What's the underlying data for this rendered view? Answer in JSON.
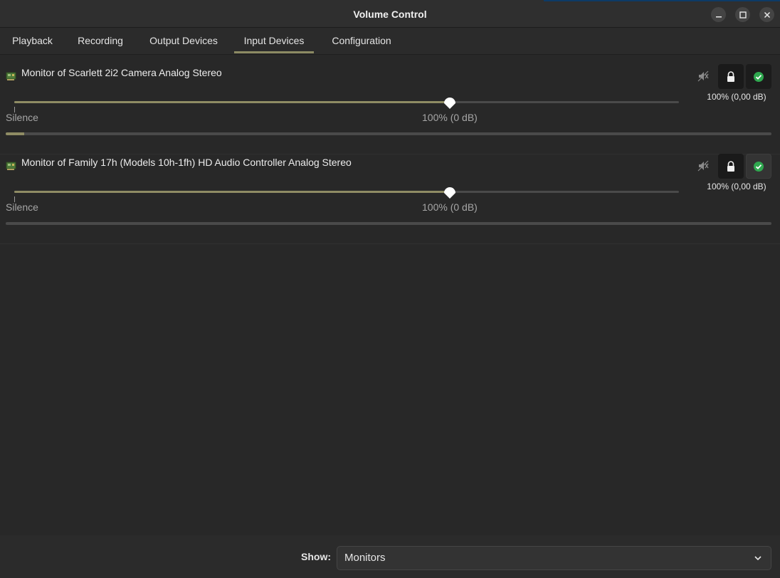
{
  "window": {
    "title": "Volume Control",
    "controls": [
      "minimize",
      "maximize",
      "close"
    ]
  },
  "tabs": [
    {
      "label": "Playback",
      "selected": false
    },
    {
      "label": "Recording",
      "selected": false
    },
    {
      "label": "Output Devices",
      "selected": false
    },
    {
      "label": "Input Devices",
      "selected": true
    },
    {
      "label": "Configuration",
      "selected": false
    }
  ],
  "devices": [
    {
      "name": "Monitor of Scarlett 2i2 Camera Analog Stereo",
      "volume_text": "100% (0,00 dB)",
      "slider_percent": 100,
      "label_silence": "Silence",
      "label_100": "100% (0 dB)",
      "level_fraction": 0.025,
      "muted": false,
      "locked": true,
      "is_default": true
    },
    {
      "name": "Monitor of Family 17h (Models 10h-1fh) HD Audio Controller Analog Stereo",
      "volume_text": "100% (0,00 dB)",
      "slider_percent": 100,
      "label_silence": "Silence",
      "label_100": "100% (0 dB)",
      "level_fraction": 0.0,
      "muted": false,
      "locked": true,
      "is_default": false
    }
  ],
  "footer": {
    "show_label": "Show:",
    "show_value": "Monitors"
  },
  "colors": {
    "accent": "#8f8c64",
    "check": "#2fa84f",
    "background": "#282828"
  }
}
